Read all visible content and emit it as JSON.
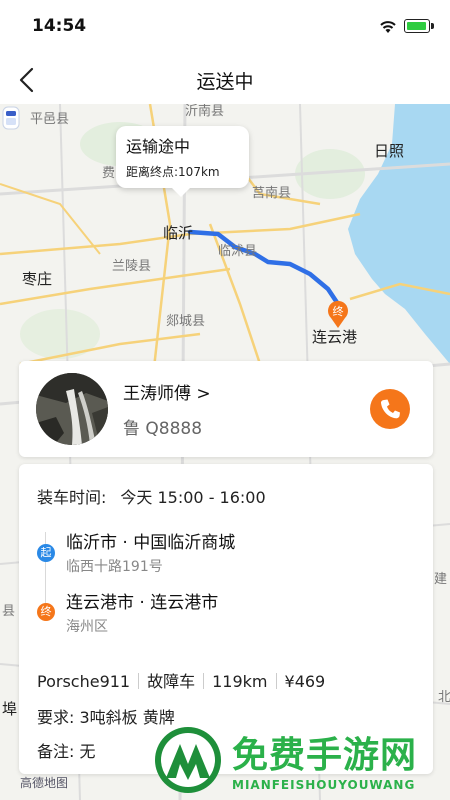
{
  "status_bar": {
    "time": "14:54"
  },
  "nav": {
    "title": "运送中"
  },
  "map": {
    "cities": {
      "pingyi": "平邑县",
      "yishui": "沂南县",
      "rizhao": "日照",
      "fei": "费",
      "junan": "莒南县",
      "linyi": "临沂",
      "lanling": "兰陵县",
      "linshu": "临沭县",
      "zaozhuang": "枣庄",
      "tancheng": "郯城县",
      "lianyungang": "连云港",
      "edge_left1": "县",
      "edge_left2": "埠",
      "edge_right1": "建",
      "edge_right2": "北"
    },
    "bubble_title": "运输途中",
    "bubble_distance": "距离终点:107km",
    "end_marker": "终",
    "attribution": "高德地图"
  },
  "driver": {
    "name": "王涛师傅 >",
    "plate": "鲁 Q8888"
  },
  "order": {
    "load_label": "装车时间:",
    "load_time": "今天 15:00 - 16:00",
    "start_badge": "起",
    "start_title": "临沂市 · 中国临沂商城",
    "start_sub": "临西十路191号",
    "end_badge": "终",
    "end_title": "连云港市 · 连云港市",
    "end_sub": "海州区",
    "car_model": "Porsche911",
    "car_status": "故障车",
    "distance": "119km",
    "price": "¥469",
    "requirement": "要求: 3吨斜板 黄牌",
    "note": "备注: 无"
  },
  "watermark": {
    "text": "免费手游网",
    "sub": "MIANFEISHOUYOUWANG"
  },
  "colors": {
    "accent_orange": "#f5761a",
    "start_blue": "#2a89e6",
    "route_blue": "#2f6fe6",
    "sea": "#a8d8f2",
    "watermark_green": "#2bb14a"
  }
}
